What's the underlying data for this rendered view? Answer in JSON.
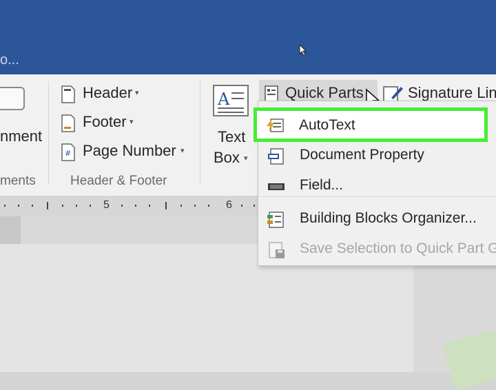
{
  "window": {
    "title_fragment": "o..."
  },
  "ribbon": {
    "comments_group": {
      "button_label": "nment",
      "group_label": "ments"
    },
    "header_footer_group": {
      "header": "Header",
      "footer": "Footer",
      "page_number": "Page Number",
      "group_label": "Header & Footer"
    },
    "text_group": {
      "text_box_line1": "Text",
      "text_box_line2": "Box",
      "quick_parts": "Quick Parts",
      "signature_line": "Signature Lin"
    }
  },
  "ruler": {
    "labels": [
      "5",
      "6"
    ]
  },
  "quick_parts_menu": {
    "items": [
      {
        "label": "AutoText",
        "icon": "autotext-icon",
        "enabled": true,
        "highlighted": true
      },
      {
        "label": "Document Property",
        "icon": "document-property-icon",
        "enabled": true
      },
      {
        "label": "Field...",
        "icon": "field-icon",
        "enabled": true
      },
      {
        "label": "Building Blocks Organizer...",
        "icon": "building-blocks-icon",
        "enabled": true
      },
      {
        "label": "Save Selection to Quick Part G",
        "icon": "save-selection-icon",
        "enabled": false
      }
    ]
  },
  "colors": {
    "title_bar": "#2b579a",
    "ribbon_bg": "#f1f1f1",
    "highlight_outline": "#44ee33"
  }
}
